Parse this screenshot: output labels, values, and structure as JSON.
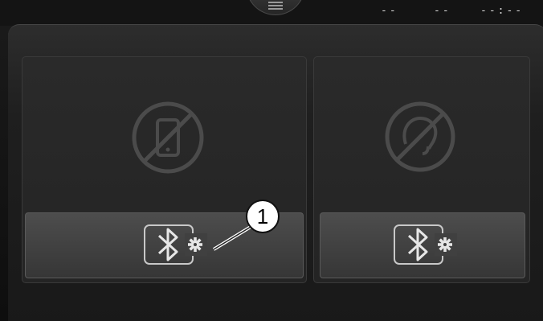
{
  "status_bar": {
    "menu_icon": "hamburger-menu-icon",
    "field_a": "--",
    "field_b": "--",
    "clock": "--:--"
  },
  "device_panels": [
    {
      "status_icon": "no-phone-icon",
      "button_icon": "bluetooth-settings-icon"
    },
    {
      "status_icon": "no-audio-device-icon",
      "button_icon": "bluetooth-settings-icon"
    }
  ],
  "callout": {
    "label": "1"
  }
}
